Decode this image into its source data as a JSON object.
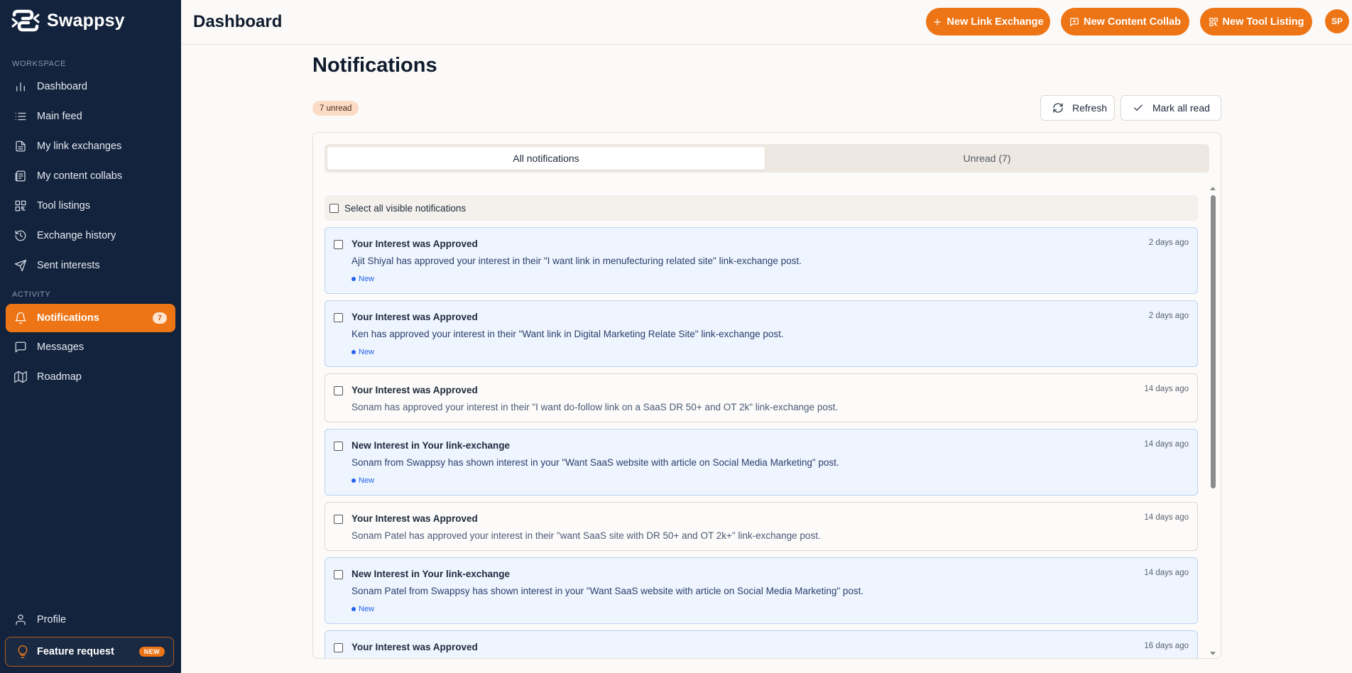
{
  "brand": {
    "name": "Swappsy"
  },
  "sidebar": {
    "workspace_label": "WORKSPACE",
    "activity_label": "ACTIVITY",
    "workspace_items": [
      {
        "label": "Dashboard",
        "icon": "bar-chart-icon"
      },
      {
        "label": "Main feed",
        "icon": "list-icon"
      },
      {
        "label": "My link exchanges",
        "icon": "document-icon"
      },
      {
        "label": "My content collabs",
        "icon": "newspaper-icon"
      },
      {
        "label": "Tool listings",
        "icon": "qr-grid-icon"
      },
      {
        "label": "Exchange history",
        "icon": "history-icon"
      },
      {
        "label": "Sent interests",
        "icon": "send-icon"
      }
    ],
    "activity_items": [
      {
        "label": "Notifications",
        "icon": "bell-icon",
        "badge": "7",
        "active": true
      },
      {
        "label": "Messages",
        "icon": "message-icon"
      },
      {
        "label": "Roadmap",
        "icon": "map-icon"
      }
    ],
    "profile_label": "Profile",
    "feature_request_label": "Feature request",
    "feature_request_badge": "NEW"
  },
  "header": {
    "title": "Dashboard",
    "buttons": {
      "link_exchange": "New Link Exchange",
      "content_collab": "New Content Collab",
      "tool_listing": "New Tool Listing"
    },
    "avatar_initials": "SP",
    "accent_color": "#ee7516"
  },
  "main": {
    "title": "Notifications",
    "unread_label": "7 unread",
    "refresh_label": "Refresh",
    "mark_all_label": "Mark all read",
    "tabs": {
      "all": "All notifications",
      "unread": "Unread (7)"
    },
    "select_all_label": "Select all visible notifications",
    "new_label": "New",
    "notifications": [
      {
        "title": "Your Interest was Approved",
        "time": "2 days ago",
        "body": "Ajit Shiyal has approved your interest in their \"I want link in menufecturing related site\" link-exchange post.",
        "unread": true
      },
      {
        "title": "Your Interest was Approved",
        "time": "2 days ago",
        "body": "Ken has approved your interest in their \"Want link in Digital Marketing Relate Site\" link-exchange post.",
        "unread": true
      },
      {
        "title": "Your Interest was Approved",
        "time": "14 days ago",
        "body": "Sonam has approved your interest in their \"I want do-follow link on a SaaS DR 50+ and OT 2k\" link-exchange post.",
        "unread": false
      },
      {
        "title": "New Interest in Your link-exchange",
        "time": "14 days ago",
        "body": "Sonam from Swappsy has shown interest in your \"Want SaaS website with article on Social Media Marketing\" post.",
        "unread": true
      },
      {
        "title": "Your Interest was Approved",
        "time": "14 days ago",
        "body": "Sonam Patel has approved your interest in their \"want SaaS site with DR 50+ and OT 2k+\" link-exchange post.",
        "unread": false
      },
      {
        "title": "New Interest in Your link-exchange",
        "time": "14 days ago",
        "body": "Sonam Patel from Swappsy has shown interest in your \"Want SaaS website with article on Social Media Marketing\" post.",
        "unread": true
      },
      {
        "title": "Your Interest was Approved",
        "time": "16 days ago",
        "body": "",
        "unread": true
      }
    ]
  }
}
